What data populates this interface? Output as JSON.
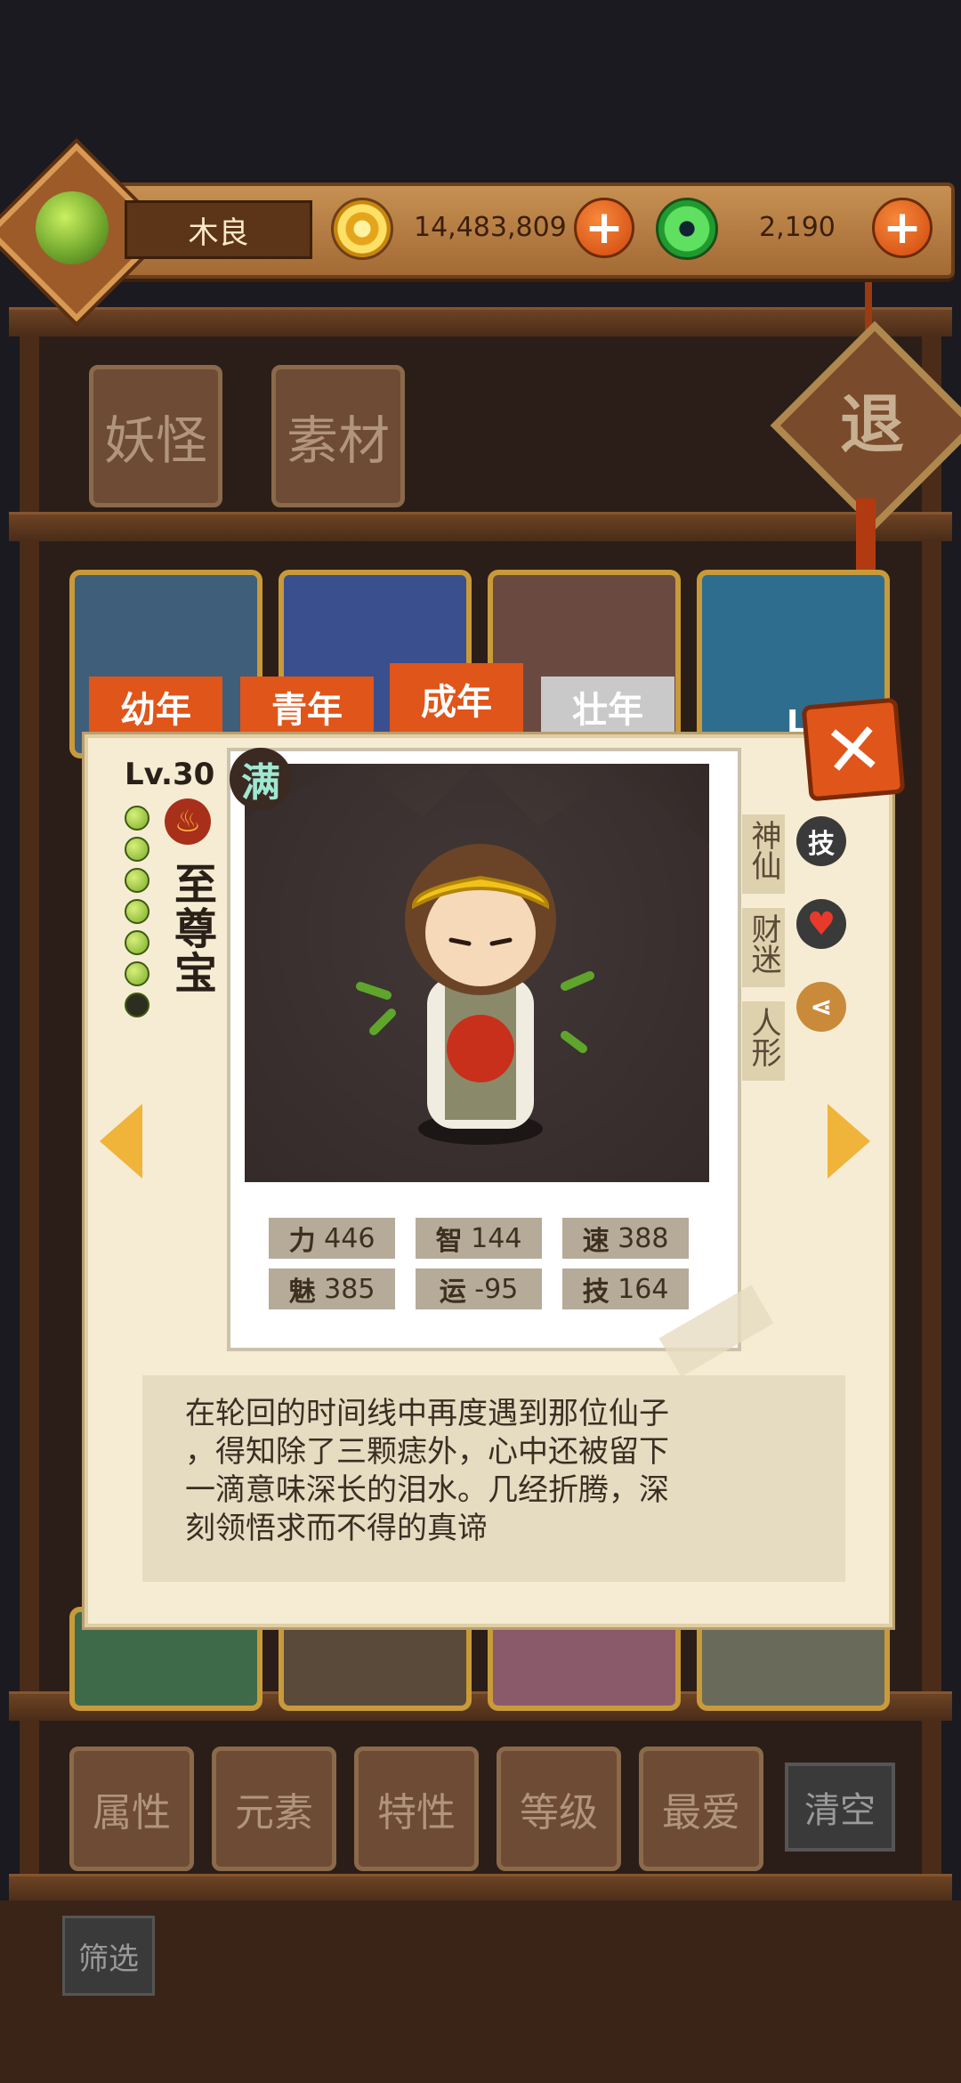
{
  "header": {
    "player_name": "木良",
    "gold_amount": "14,483,809",
    "jade_amount": "2,190"
  },
  "top_tabs": [
    "妖怪",
    "素材"
  ],
  "exit_label": "退",
  "age_tabs": [
    "幼年",
    "青年",
    "成年",
    "壮年"
  ],
  "card_partial_label": "Lv",
  "character": {
    "level": "Lv.30",
    "max_badge": "满",
    "name": "至尊宝",
    "traits": [
      "神仙",
      "财迷",
      "人形"
    ],
    "trait_icon_skill": "技"
  },
  "stats": [
    {
      "label": "力",
      "value": "446"
    },
    {
      "label": "智",
      "value": "144"
    },
    {
      "label": "速",
      "value": "388"
    },
    {
      "label": "魅",
      "value": "385"
    },
    {
      "label": "运",
      "value": "-95"
    },
    {
      "label": "技",
      "value": "164"
    }
  ],
  "description_lines": [
    "在轮回的时间线中再度遇到那位仙子",
    "，得知除了三颗痣外，心中还被留下",
    "一滴意味深长的泪水。几经折腾，深",
    "刻领悟求而不得的真谛"
  ],
  "bottom_buttons": [
    "属性",
    "元素",
    "特性",
    "等级",
    "最爱"
  ],
  "clear_label": "清空",
  "filter_label": "筛选",
  "icons": [
    "gold-coin-icon",
    "jade-coin-icon",
    "plus-icon",
    "close-icon",
    "fire-element-icon",
    "arrow-left-icon",
    "arrow-right-icon",
    "heart-icon",
    "share-icon"
  ],
  "colors": {
    "accent_orange": "#e0551a",
    "panel": "#f5ecd3",
    "wood": "#6e4b34"
  }
}
